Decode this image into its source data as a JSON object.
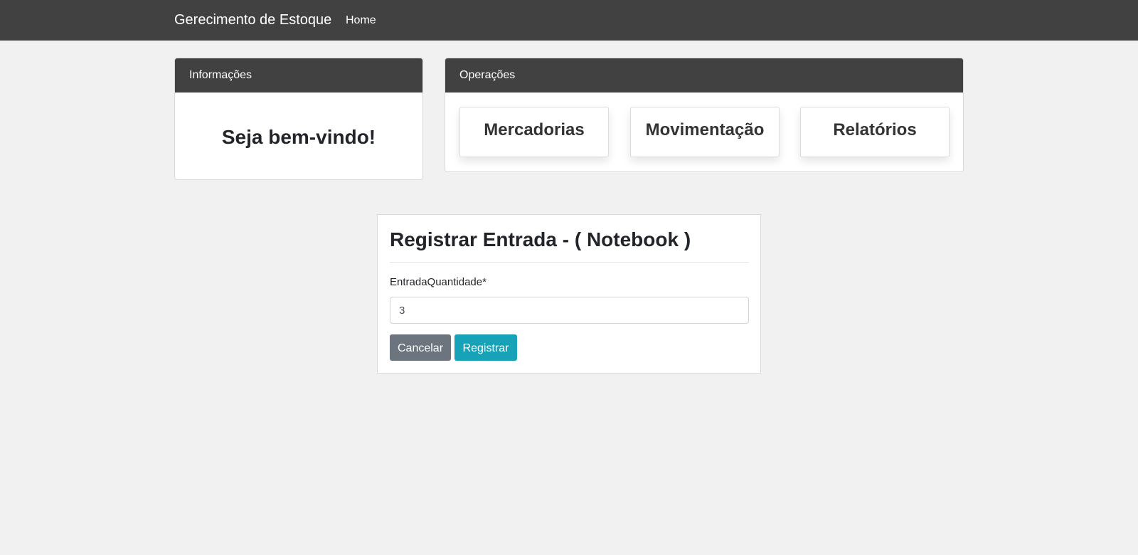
{
  "navbar": {
    "brand": "Gerecimento de Estoque",
    "home_link": "Home"
  },
  "info_panel": {
    "header": "Informações",
    "welcome": "Seja bem-vindo!"
  },
  "operations_panel": {
    "header": "Operações",
    "buttons": [
      {
        "label": "Mercadorias"
      },
      {
        "label": "Movimentação"
      },
      {
        "label": "Relatórios"
      }
    ]
  },
  "form": {
    "title": "Registrar Entrada - ( Notebook )",
    "quantity_label": "EntradaQuantidade*",
    "quantity_value": "3",
    "cancel_label": "Cancelar",
    "submit_label": "Registrar"
  },
  "colors": {
    "navbar": "#414141",
    "background": "#f1f1f1",
    "cancel_button": "#6c757d",
    "submit_button": "#17a2b8"
  }
}
